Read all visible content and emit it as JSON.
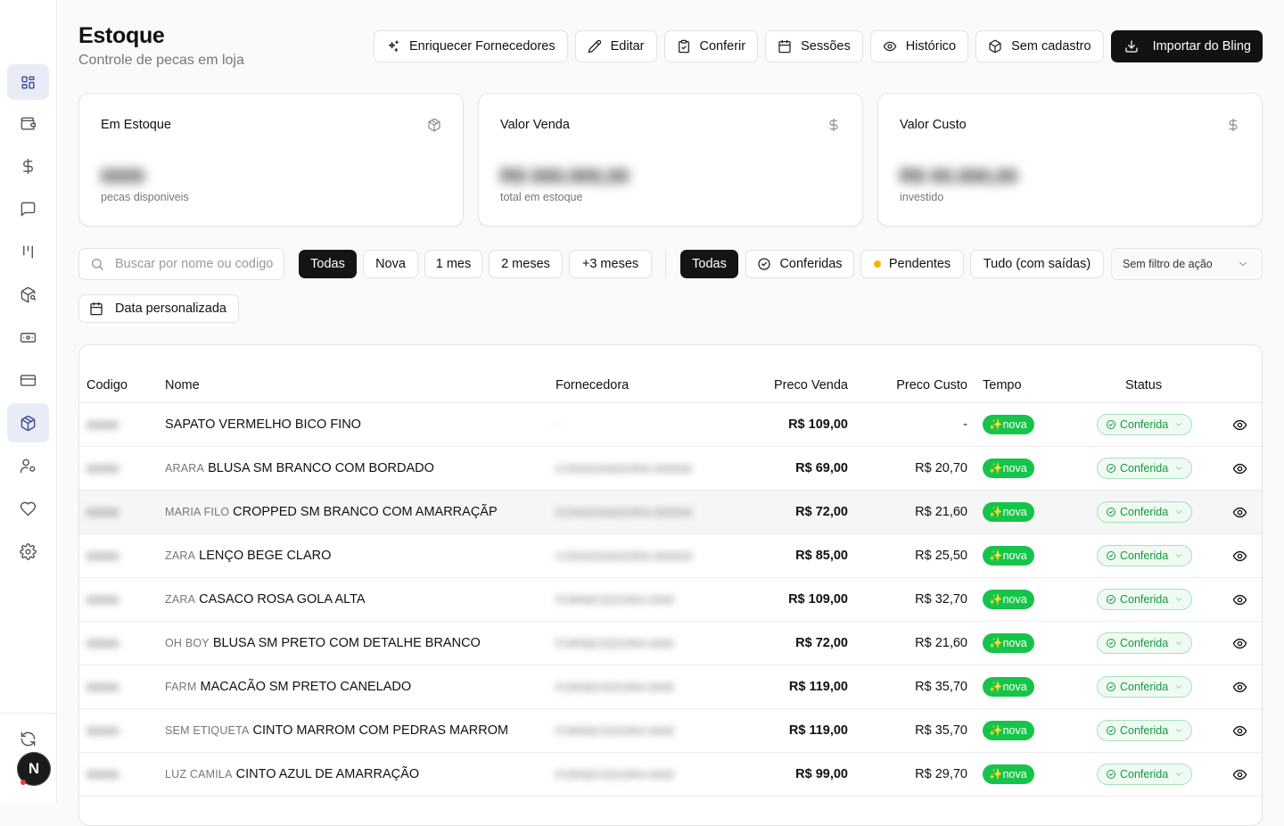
{
  "header": {
    "title": "Estoque",
    "subtitle": "Controle de pecas em loja"
  },
  "toolbar": {
    "enrich": "Enriquecer Fornecedores",
    "edit": "Editar",
    "check": "Conferir",
    "sessions": "Sessões",
    "history": "Histórico",
    "unregistered": "Sem cadastro",
    "import": "Importar do Bling"
  },
  "cards": [
    {
      "title": "Em Estoque",
      "value": "0000",
      "caption": "pecas disponiveis",
      "icon": "box-icon"
    },
    {
      "title": "Valor Venda",
      "value": "R$ 000.000,00",
      "caption": "total em estoque",
      "icon": "dollar-icon"
    },
    {
      "title": "Valor Custo",
      "value": "R$ 00.000,00",
      "caption": "investido",
      "icon": "dollar-icon"
    }
  ],
  "filters": {
    "search_placeholder": "Buscar por nome ou codigo",
    "age": [
      "Todas",
      "Nova",
      "1 mes",
      "2 meses",
      "+3 meses"
    ],
    "status": [
      "Todas",
      "Conferidas",
      "Pendentes",
      "Tudo (com saídas)"
    ],
    "action_select": "Sem filtro de ação",
    "custom_date": "Data personalizada"
  },
  "table": {
    "columns": {
      "code": "Codigo",
      "name": "Nome",
      "supplier": "Fornecedora",
      "sale_price": "Preco Venda",
      "cost_price": "Preco Custo",
      "age": "Tempo",
      "status": "Status"
    },
    "rows": [
      {
        "code": "00000",
        "brand": "",
        "name": "SAPATO VERMELHO BICO FINO",
        "supplier": "-",
        "sale": "R$ 109,00",
        "cost": "-",
        "age": "✨nova",
        "status": "Conferida"
      },
      {
        "code": "00000",
        "brand": "ARARA",
        "name": "BLUSA SM BRANCO COM BORDADO",
        "supplier": "CONSIGNADORA 000000",
        "sale": "R$ 69,00",
        "cost": "R$ 20,70",
        "age": "✨nova",
        "status": "Conferida"
      },
      {
        "code": "00000",
        "brand": "MARIA FILO",
        "name": "CROPPED SM BRANCO COM AMARRAÇÃP",
        "supplier": "CONSIGNADORA 000000",
        "sale": "R$ 72,00",
        "cost": "R$ 21,60",
        "age": "✨nova",
        "status": "Conferida"
      },
      {
        "code": "00000",
        "brand": "ZARA",
        "name": "LENÇO BEGE CLARO",
        "supplier": "CONSIGNADORA 000000",
        "sale": "R$ 85,00",
        "cost": "R$ 25,50",
        "age": "✨nova",
        "status": "Conferida"
      },
      {
        "code": "00000",
        "brand": "ZARA",
        "name": "CASACO ROSA GOLA ALTA",
        "supplier": "FORNECEDORA 0000",
        "sale": "R$ 109,00",
        "cost": "R$ 32,70",
        "age": "✨nova",
        "status": "Conferida"
      },
      {
        "code": "00000",
        "brand": "OH BOY",
        "name": "BLUSA SM PRETO COM DETALHE BRANCO",
        "supplier": "FORNECEDORA 0000",
        "sale": "R$ 72,00",
        "cost": "R$ 21,60",
        "age": "✨nova",
        "status": "Conferida"
      },
      {
        "code": "00000",
        "brand": "FARM",
        "name": "MACACÃO SM PRETO CANELADO",
        "supplier": "FORNECEDORA 0000",
        "sale": "R$ 119,00",
        "cost": "R$ 35,70",
        "age": "✨nova",
        "status": "Conferida"
      },
      {
        "code": "00000",
        "brand": "SEM ETIQUETA",
        "name": "CINTO MARROM COM PEDRAS MARROM",
        "supplier": "FORNECEDORA 0000",
        "sale": "R$ 119,00",
        "cost": "R$ 35,70",
        "age": "✨nova",
        "status": "Conferida"
      },
      {
        "code": "00000",
        "brand": "LUZ CAMILA",
        "name": "CINTO AZUL DE AMARRAÇÃO",
        "supplier": "FORNECEDORA 0000",
        "sale": "R$ 99,00",
        "cost": "R$ 29,70",
        "age": "✨nova",
        "status": "Conferida"
      }
    ]
  },
  "user": {
    "initial": "N"
  },
  "colors": {
    "accent": "#141414",
    "nova_green": "#16c44a",
    "conferida_green": "#139a40",
    "pending_yellow": "#f4b400",
    "sidebar_active": "#e9ecf7"
  }
}
